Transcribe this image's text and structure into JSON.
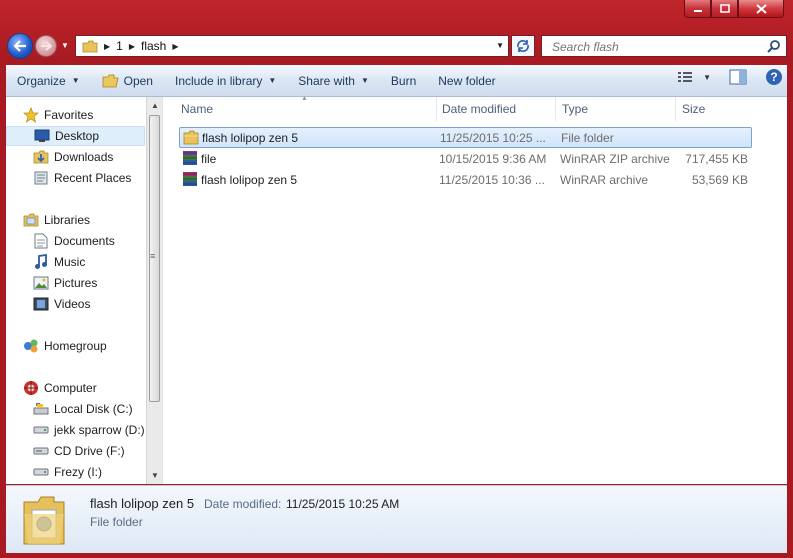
{
  "address": {
    "crumbs": [
      "1",
      "flash"
    ]
  },
  "search": {
    "placeholder": "Search flash"
  },
  "toolbar": {
    "organize": "Organize",
    "open": "Open",
    "include_in_library": "Include in library",
    "share_with": "Share with",
    "burn": "Burn",
    "new_folder": "New folder"
  },
  "nav": {
    "favorites": "Favorites",
    "desktop": "Desktop",
    "downloads": "Downloads",
    "recent_places": "Recent Places",
    "libraries": "Libraries",
    "documents": "Documents",
    "music": "Music",
    "pictures": "Pictures",
    "videos": "Videos",
    "homegroup": "Homegroup",
    "computer": "Computer",
    "local_disk": "Local Disk (C:)",
    "jekk": "jekk sparrow (D:)",
    "cd_drive": "CD Drive (F:)",
    "frezy": "Frezy (I:)"
  },
  "columns": {
    "name": "Name",
    "date_modified": "Date modified",
    "type": "Type",
    "size": "Size"
  },
  "files": [
    {
      "name": "flash lolipop zen 5",
      "date": "11/25/2015 10:25 ...",
      "type": "File folder",
      "size": "",
      "icon": "folder-icon",
      "selected": true
    },
    {
      "name": "file",
      "date": "10/15/2015 9:36 AM",
      "type": "WinRAR ZIP archive",
      "size": "717,455 KB",
      "icon": "winrar-zip-icon",
      "selected": false
    },
    {
      "name": "flash lolipop zen 5",
      "date": "11/25/2015 10:36 ...",
      "type": "WinRAR archive",
      "size": "53,569 KB",
      "icon": "winrar-archive-icon",
      "selected": false
    }
  ],
  "details": {
    "name": "flash lolipop zen 5",
    "date_label": "Date modified:",
    "date_value": "11/25/2015 10:25 AM",
    "type": "File folder"
  },
  "colors": {
    "frame": "#b51f26",
    "selection": "#cfe4fa",
    "toolbar_text": "#1e395b"
  }
}
